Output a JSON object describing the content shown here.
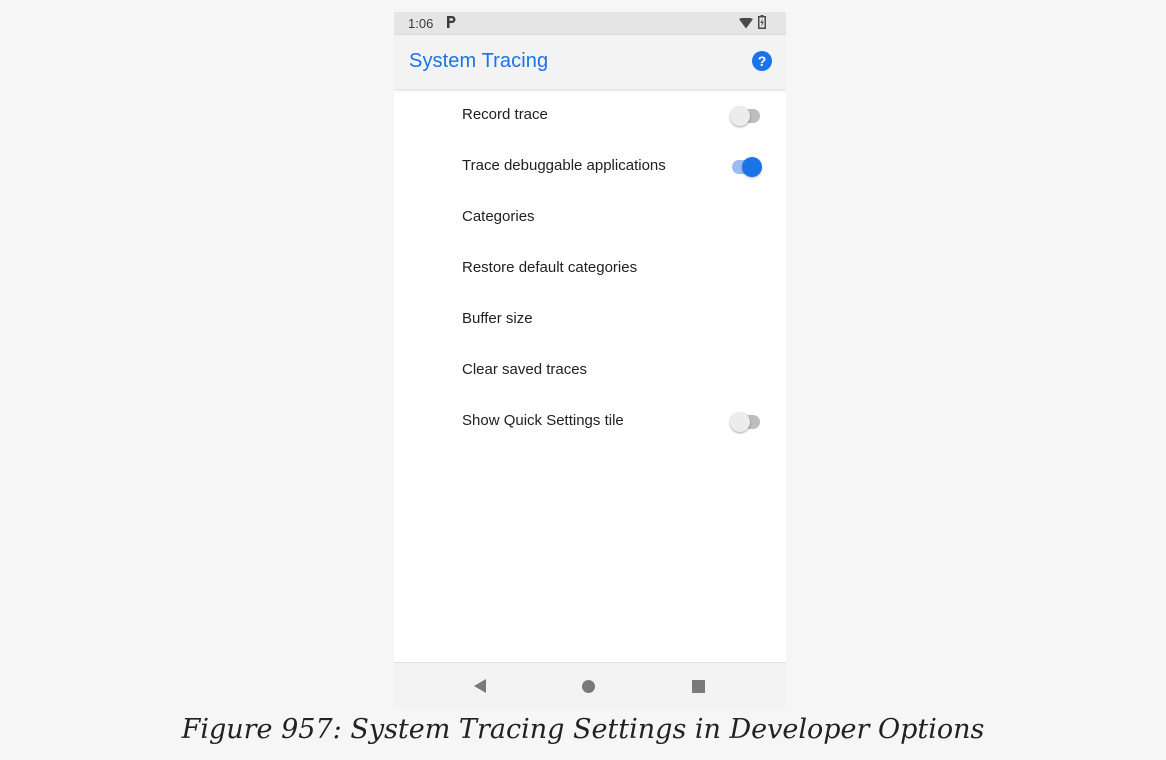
{
  "status_bar": {
    "time": "1:06",
    "notification_icon": "p-icon",
    "wifi_icon": "wifi-icon",
    "battery_icon": "battery-icon"
  },
  "app_bar": {
    "title": "System Tracing",
    "help_icon": "help-icon",
    "accent_color": "#1a73e8"
  },
  "settings": [
    {
      "label": "Record trace",
      "has_switch": true,
      "switch_on": false
    },
    {
      "label": "Trace debuggable applications",
      "has_switch": true,
      "switch_on": true
    },
    {
      "label": "Categories",
      "has_switch": false
    },
    {
      "label": "Restore default categories",
      "has_switch": false
    },
    {
      "label": "Buffer size",
      "has_switch": false
    },
    {
      "label": "Clear saved traces",
      "has_switch": false
    },
    {
      "label": "Show Quick Settings tile",
      "has_switch": true,
      "switch_on": false
    }
  ],
  "nav_bar": {
    "back_icon": "back-triangle-icon",
    "home_icon": "home-circle-icon",
    "recents_icon": "recents-square-icon"
  },
  "caption": "Figure 957: System Tracing Settings in Developer Options"
}
